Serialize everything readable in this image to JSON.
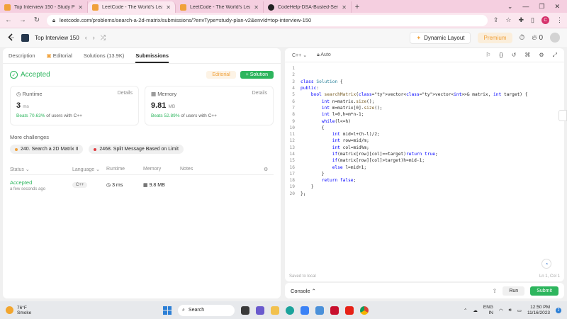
{
  "browser": {
    "tabs": [
      {
        "title": "Top Interview 150 - Study Plan",
        "color": "#f0a13a"
      },
      {
        "title": "LeetCode - The World's Leading",
        "color": "#f0a13a",
        "active": true
      },
      {
        "title": "LeetCode - The World's Leading",
        "color": "#f0a13a"
      },
      {
        "title": "CodeHelp-DSA-Busted-Series/Le",
        "color": "#222222"
      }
    ],
    "url": "leetcode.com/problems/search-a-2d-matrix/submissions/?envType=study-plan-v2&envId=top-interview-150",
    "profile_initial": "C"
  },
  "lc_nav": {
    "title": "Top Interview 150",
    "dynamic_layout": "Dynamic Layout",
    "premium": "Premium",
    "streak": "0"
  },
  "left": {
    "tabs": {
      "description": "Description",
      "editorial": "Editorial",
      "solutions": "Solutions (13.9K)",
      "submissions": "Submissions"
    },
    "status": "Accepted",
    "editorial_btn": "Editorial",
    "solution_btn": "+ Solution",
    "runtime": {
      "label": "Runtime",
      "details": "Details",
      "value": "3",
      "unit": "ms",
      "beats": "Beats 70.63%",
      "suffix": "of users with C++"
    },
    "memory": {
      "label": "Memory",
      "details": "Details",
      "value": "9.81",
      "unit": "MB",
      "beats": "Beats 52.89%",
      "suffix": "of users with C++"
    },
    "more_challenges": "More challenges",
    "challenges": [
      {
        "label": "240. Search a 2D Matrix II",
        "color": "#f0a13a"
      },
      {
        "label": "2468. Split Message Based on Limit",
        "color": "#e0393e"
      }
    ],
    "table_headers": {
      "status": "Status",
      "language": "Language",
      "runtime": "Runtime",
      "memory": "Memory",
      "notes": "Notes"
    },
    "submission": {
      "status": "Accepted",
      "when": "a few seconds ago",
      "language": "C++",
      "runtime": "3 ms",
      "memory": "9.8 MB"
    }
  },
  "editor": {
    "language": "C++",
    "mode": "Auto",
    "saved": "Saved to local",
    "position": "Ln 1, Col 1",
    "lines": [
      "",
      "",
      "class Solution {",
      "public:",
      "    bool searchMatrix(vector<vector<int>>& matrix, int target) {",
      "        int n=matrix.size();",
      "        int m=matrix[0].size();",
      "        int l=0,h=m*n-1;",
      "        while(l<=h)",
      "        {",
      "            int mid=l+(h-l)/2;",
      "            int row=mid/m;",
      "            int col=mid%m;",
      "            if(matrix[row][col]==target)return true;",
      "            if(matrix[row][col]>target)h=mid-1;",
      "            else l=mid+1;",
      "        }",
      "        return false;",
      "    }",
      "};"
    ]
  },
  "console": {
    "label": "Console",
    "run": "Run",
    "submit": "Submit"
  },
  "taskbar": {
    "temp": "76°F",
    "weather": "Smoke",
    "search": "Search",
    "lang": "ENG",
    "region": "IN",
    "time": "12:50 PM",
    "date": "11/16/2023",
    "notifications": "2"
  }
}
